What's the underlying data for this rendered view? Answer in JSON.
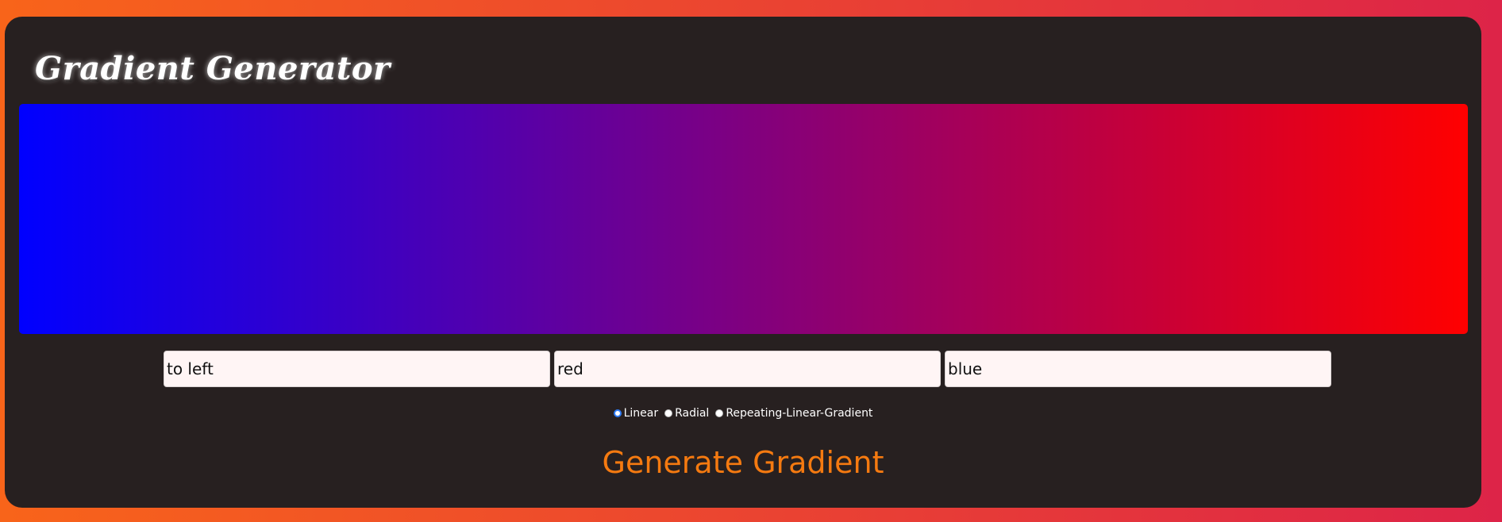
{
  "header": {
    "title": "Gradient Generator"
  },
  "preview": {
    "direction": "to left",
    "color_start": "red",
    "color_end": "blue"
  },
  "inputs": {
    "direction_value": "to left",
    "color1_value": "red",
    "color2_value": "blue"
  },
  "gradient_types": {
    "selected": "Linear",
    "options": [
      "Linear",
      "Radial",
      "Repeating-Linear-Gradient"
    ]
  },
  "actions": {
    "generate_label": "Generate Gradient"
  },
  "colors": {
    "page_gradient_start": "#f8641a",
    "page_gradient_end": "#dd2448",
    "card_background": "#272020",
    "accent": "#f57a10",
    "radio_checked": "#2f7cf6"
  }
}
